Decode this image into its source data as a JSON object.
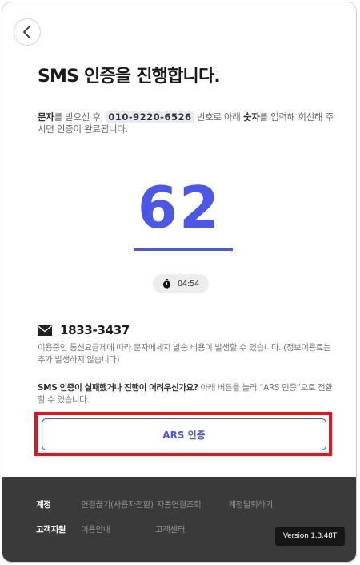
{
  "title": "SMS 인증을 진행합니다.",
  "description": {
    "p1": "문자",
    "p2": "를 받으신 후, ",
    "phone": "010-9220-6526",
    "p3": " 번호로 아래 ",
    "p4": "숫자",
    "p5": "를 입력해 회신해 주시면 인증이 완료됩니다."
  },
  "code": "62",
  "timer": "04:54",
  "sms_number": "1833-3437",
  "fee_note": "이용중인 통신요금제에 따라 문자메세지 발송 비용이 발생할 수 있습니다. (정보이용료는 추가 발생하지 않습니다)",
  "ars_note": {
    "bold": "SMS 인증이 실패했거나 진행이 어려우신가요?",
    "rest": " 아래 버튼을 눌러 “ARS 인증”으로 전환할 수 있습니다."
  },
  "ars_button": "ARS 인증",
  "footer": {
    "account_heading": "계정",
    "account_links": [
      "연결끊기(사용자전환)",
      "자동연결조회",
      "계정탈퇴하기"
    ],
    "support_heading": "고객지원",
    "support_links": [
      "이용안내",
      "고객센터"
    ],
    "version": "Version 1.3.48T"
  },
  "colors": {
    "accent": "#4c57e6",
    "highlight_border": "#e8101a",
    "footer_bg": "#3a3a3a"
  },
  "icons": [
    "back-arrow-icon",
    "stopwatch-icon",
    "mail-icon"
  ]
}
